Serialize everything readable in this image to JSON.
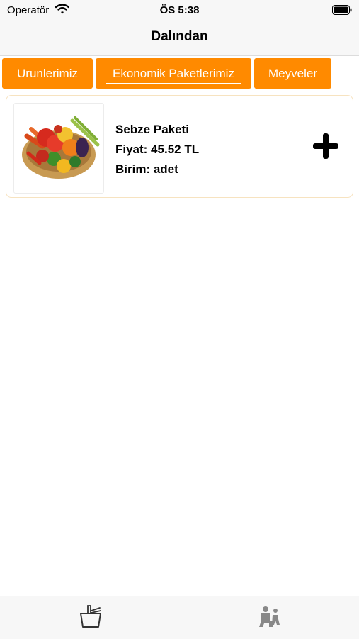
{
  "status_bar": {
    "carrier": "Operatör",
    "time": "ÖS 5:38",
    "icons": [
      "wifi-icon",
      "battery-icon"
    ]
  },
  "nav": {
    "title": "Dalından"
  },
  "tabs": [
    {
      "label": "Urunlerimiz",
      "selected": false
    },
    {
      "label": "Ekonomik Paketlerimiz",
      "selected": true
    },
    {
      "label": "Meyveler",
      "selected": false
    }
  ],
  "products": [
    {
      "name": "Sebze Paketi",
      "price": "Fiyat: 45.52 TL",
      "unit": "Birim: adet",
      "image": "vegetable-basket-image",
      "action_icon": "plus-icon"
    }
  ],
  "tab_bar": {
    "items": [
      {
        "icon": "basket-icon"
      },
      {
        "icon": "person-icon"
      }
    ]
  },
  "colors": {
    "accent": "#ff8a00",
    "bar_background": "#f7f7f7",
    "card_border": "#f7e3c0"
  }
}
